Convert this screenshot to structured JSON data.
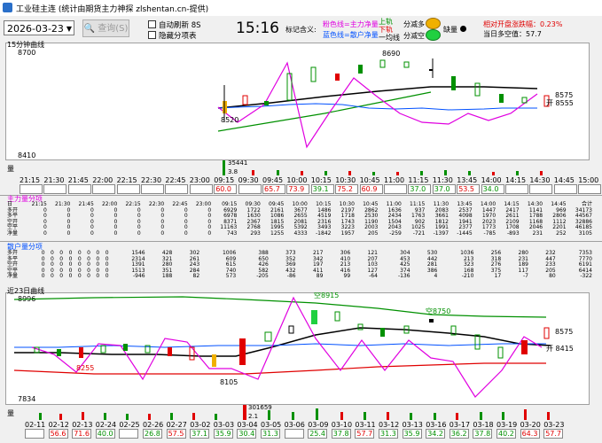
{
  "window": {
    "title": "工业硅主连 (统计由期货主力神探 zlshentan.cn-提供)"
  },
  "toolbar": {
    "date": "2026-03-23",
    "query_label": "查询(S)",
    "auto_refresh_label": "自动刷新 8S",
    "hide_panel_label": "隐藏分项表",
    "time": "15:16",
    "legend_label": "标记含义:",
    "pink_line_label": "粉色线=主力净量",
    "blue_line_label": "蓝色线=散户净量",
    "up_track_label": "上轨",
    "down_track_label": "下轨",
    "one_line_label": "一均线",
    "buy_more_label": "加多",
    "sell_label": "加空",
    "minus_more_label": "分减多",
    "minus_short_label": "分减空",
    "liq_label": "缺量",
    "rel_open_label": "相对开盘涨跌幅：",
    "rel_open_value": "0.23%",
    "day_balance_label": "当日多空值：",
    "day_balance_value": "57.7",
    "colors": {
      "pink": "#e000e0",
      "blue": "#0050ff",
      "green": "#009000",
      "red": "#e00000",
      "gold": "#f0b000"
    }
  },
  "minute_chart": {
    "title": "15分钟曲线",
    "y_high": "8700",
    "y_low": "8410",
    "low_mark": "8520",
    "high_mark": "8690",
    "right_price": "8575",
    "open_label": "开 8555",
    "volume_label": "量",
    "volume_peak": "35441",
    "volume_ratio": "3.8",
    "times": [
      "21:15",
      "21:30",
      "21:45",
      "22:00",
      "22:15",
      "22:30",
      "22:45",
      "23:00",
      "09:15",
      "09:30",
      "09:45",
      "10:00",
      "10:15",
      "10:30",
      "10:45",
      "11:00",
      "11:15",
      "11:30",
      "13:45",
      "14:00",
      "14:15",
      "14:30",
      "14:45",
      "15:00"
    ],
    "ratios": [
      "",
      "",
      "",
      "",
      "",
      "",
      "",
      "",
      "60.0",
      "",
      "65.7",
      "73.9",
      "39.1",
      "75.2",
      "60.9",
      "",
      "37.0",
      "37.0",
      "53.5",
      "34.0",
      "",
      "",
      "",
      ""
    ],
    "ratio_colors": [
      "",
      "",
      "",
      "",
      "",
      "",
      "",
      "",
      "#e00000",
      "",
      "#e00000",
      "#e00000",
      "#009000",
      "#e00000",
      "#e00000",
      "",
      "#009000",
      "#009000",
      "#e00000",
      "#009000",
      "",
      "",
      "",
      ""
    ]
  },
  "flow_main": {
    "title": "主力量分项",
    "rows": [
      {
        "label": "多开",
        "values": [
          "0",
          "0",
          "0",
          "0",
          "0",
          "0",
          "0",
          "0",
          "6929",
          "1722",
          "2161",
          "3677",
          "1486",
          "2197",
          "2862",
          "1636",
          "937",
          "2083",
          "2537",
          "1447",
          "2417",
          "1141",
          "969",
          "34173"
        ]
      },
      {
        "label": "多平",
        "values": [
          "0",
          "0",
          "0",
          "0",
          "0",
          "0",
          "0",
          "0",
          "6978",
          "1630",
          "1086",
          "2655",
          "4519",
          "1718",
          "2530",
          "2434",
          "1763",
          "3661",
          "4098",
          "1970",
          "2611",
          "1788",
          "2806",
          "44567"
        ]
      },
      {
        "label": "空开",
        "values": [
          "0",
          "0",
          "0",
          "0",
          "0",
          "0",
          "0",
          "0",
          "8371",
          "2367",
          "1815",
          "2081",
          "2316",
          "1743",
          "1190",
          "1504",
          "902",
          "1812",
          "1941",
          "2023",
          "2109",
          "1168",
          "1112",
          "32886"
        ]
      },
      {
        "label": "空平",
        "values": [
          "0",
          "0",
          "0",
          "0",
          "0",
          "0",
          "0",
          "0",
          "11163",
          "2768",
          "1995",
          "5392",
          "3493",
          "3223",
          "2003",
          "2043",
          "1025",
          "1991",
          "2377",
          "1773",
          "1708",
          "2046",
          "2201",
          "46185"
        ]
      },
      {
        "label": "净量",
        "values": [
          "0",
          "0",
          "0",
          "0",
          "0",
          "0",
          "0",
          "0",
          "743",
          "293",
          "1255",
          "4333",
          "-1842",
          "1957",
          "205",
          "-259",
          "-721",
          "-1397",
          "-1445",
          "-785",
          "-893",
          "231",
          "252",
          "3105"
        ]
      }
    ],
    "header": [
      "21:15",
      "21:30",
      "21:45",
      "22:00",
      "22:15",
      "22:30",
      "22:45",
      "23:00",
      "09:15",
      "09:30",
      "09:45",
      "10:00",
      "10:15",
      "10:30",
      "10:45",
      "11:00",
      "11:15",
      "11:30",
      "13:45",
      "14:00",
      "14:15",
      "14:30",
      "14:45",
      "合计"
    ]
  },
  "flow_retail": {
    "title": "散户量分项",
    "rows": [
      {
        "label": "多开",
        "values": [
          "0",
          "0",
          "0",
          "0",
          "0",
          "0",
          "0",
          "0",
          "1546",
          "428",
          "302",
          "1006",
          "388",
          "373",
          "217",
          "306",
          "121",
          "304",
          "530",
          "1036",
          "256",
          "280",
          "232",
          "7353"
        ]
      },
      {
        "label": "多平",
        "values": [
          "0",
          "0",
          "0",
          "0",
          "0",
          "0",
          "0",
          "0",
          "2314",
          "321",
          "261",
          "609",
          "650",
          "352",
          "342",
          "410",
          "207",
          "453",
          "442",
          "213",
          "318",
          "231",
          "447",
          "7770"
        ]
      },
      {
        "label": "空开",
        "values": [
          "0",
          "0",
          "0",
          "0",
          "0",
          "0",
          "0",
          "0",
          "1391",
          "280",
          "243",
          "615",
          "426",
          "369",
          "197",
          "213",
          "103",
          "425",
          "281",
          "323",
          "276",
          "189",
          "233",
          "6191"
        ]
      },
      {
        "label": "空平",
        "values": [
          "0",
          "0",
          "0",
          "0",
          "0",
          "0",
          "0",
          "0",
          "1513",
          "351",
          "284",
          "740",
          "582",
          "432",
          "411",
          "416",
          "127",
          "374",
          "386",
          "168",
          "375",
          "117",
          "205",
          "6414"
        ]
      },
      {
        "label": "净量",
        "values": [
          "0",
          "0",
          "0",
          "0",
          "0",
          "0",
          "0",
          "0",
          "-946",
          "188",
          "82",
          "573",
          "-205",
          "-86",
          "89",
          "99",
          "-64",
          "-136",
          "4",
          "-210",
          "17",
          "-7",
          "80",
          "-322"
        ]
      }
    ]
  },
  "daily_chart": {
    "title": "近23日曲线",
    "y_high": "8996",
    "y_low": "7834",
    "short_8915": "空8915",
    "short_8750": "空8750",
    "low_mark": "8105",
    "left_mark": "8255",
    "right_price": "8575",
    "open_label": "开 8415",
    "volume_label": "量",
    "volume_peak": "301659",
    "volume_ratio": "2.1",
    "dates": [
      "02-11",
      "02-12",
      "02-13",
      "02-24",
      "02-25",
      "02-26",
      "02-27",
      "03-02",
      "03-03",
      "03-04",
      "03-05",
      "03-06",
      "03-09",
      "03-10",
      "03-11",
      "03-12",
      "03-13",
      "03-16",
      "03-17",
      "03-18",
      "03-19",
      "03-20",
      "03-23"
    ],
    "ratios": [
      "",
      "56.6",
      "71.6",
      "40.0",
      "",
      "26.8",
      "57.5",
      "37.1",
      "35.9",
      "30.4",
      "31.3",
      "",
      "25.4",
      "37.8",
      "57.7",
      "31.3",
      "35.9",
      "34.2",
      "36.2",
      "37.8",
      "40.2",
      "64.3",
      "57.7"
    ],
    "ratio_colors": [
      "",
      "#e00000",
      "#e00000",
      "#009000",
      "",
      "#009000",
      "#e00000",
      "#009000",
      "#009000",
      "#009000",
      "#009000",
      "",
      "#009000",
      "#009000",
      "#e00000",
      "#009000",
      "#009000",
      "#009000",
      "#009000",
      "#009000",
      "#009000",
      "#e00000",
      "#e00000"
    ]
  }
}
